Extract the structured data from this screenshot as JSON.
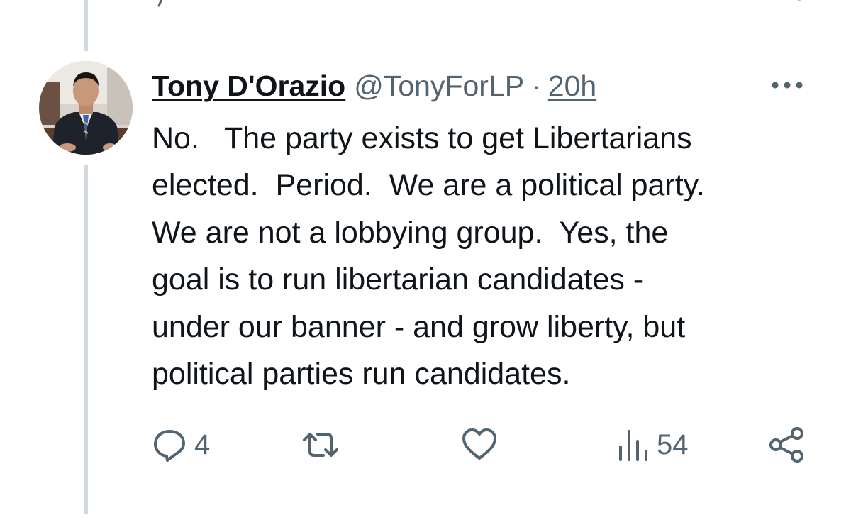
{
  "tweet": {
    "author": {
      "display_name": "Tony D'Orazio",
      "handle": "@TonyForLP",
      "avatar_icon": "person-photo-avatar"
    },
    "separator": "·",
    "timestamp": "20h",
    "more_icon": "more-horizontal-icon",
    "text_lines": [
      "No.   The party exists to get Libertarians",
      "elected.  Period.  We are a political party.",
      "We are not a lobbying group.  Yes, the",
      "goal is to run libertarian candidates -",
      "under our banner - and grow liberty, but",
      "political parties run candidates."
    ],
    "actions": {
      "reply": {
        "icon": "reply-icon",
        "count": "4"
      },
      "retweet": {
        "icon": "retweet-icon",
        "count": ""
      },
      "like": {
        "icon": "heart-icon",
        "count": ""
      },
      "views": {
        "icon": "views-bar-chart-icon",
        "count": "54"
      },
      "share": {
        "icon": "share-icon"
      }
    }
  },
  "colors": {
    "text_primary": "#0f1419",
    "text_secondary": "#536471",
    "thread_line": "#cfd9de"
  }
}
